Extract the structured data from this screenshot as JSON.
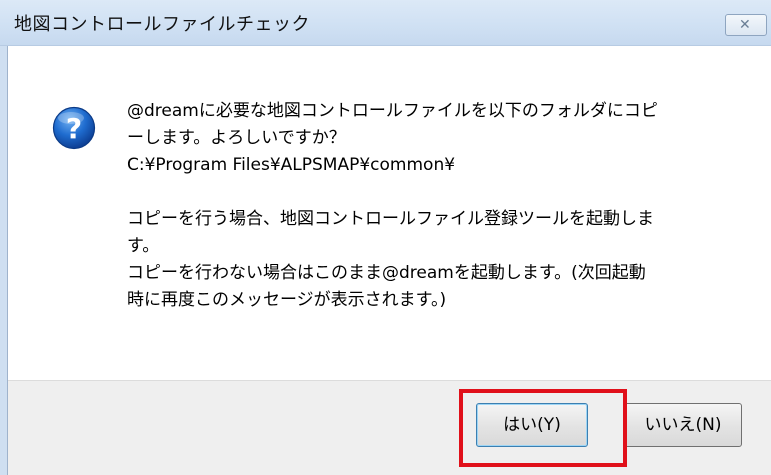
{
  "window": {
    "title": "地図コントロールファイルチェック",
    "close_glyph": "✕"
  },
  "icon": {
    "name": "question-icon",
    "glyph": "?",
    "color": "#1b64c2"
  },
  "message": {
    "lines": [
      "@dreamに必要な地図コントロールファイルを以下のフォルダにコピ",
      "ーします。よろしいですか？",
      "C:¥Program Files¥ALPSMAP¥common¥",
      "",
      "コピーを行う場合、地図コントロールファイル登録ツールを起動しま",
      "す。",
      "コピーを行わない場合はこのまま@dreamを起動します。(次回起動",
      "時に再度このメッセージが表示されます。)"
    ]
  },
  "buttons": {
    "yes_label": "はい(Y)",
    "no_label": "いいえ(N)"
  },
  "annotation": {
    "highlight_color": "#e0101a"
  }
}
